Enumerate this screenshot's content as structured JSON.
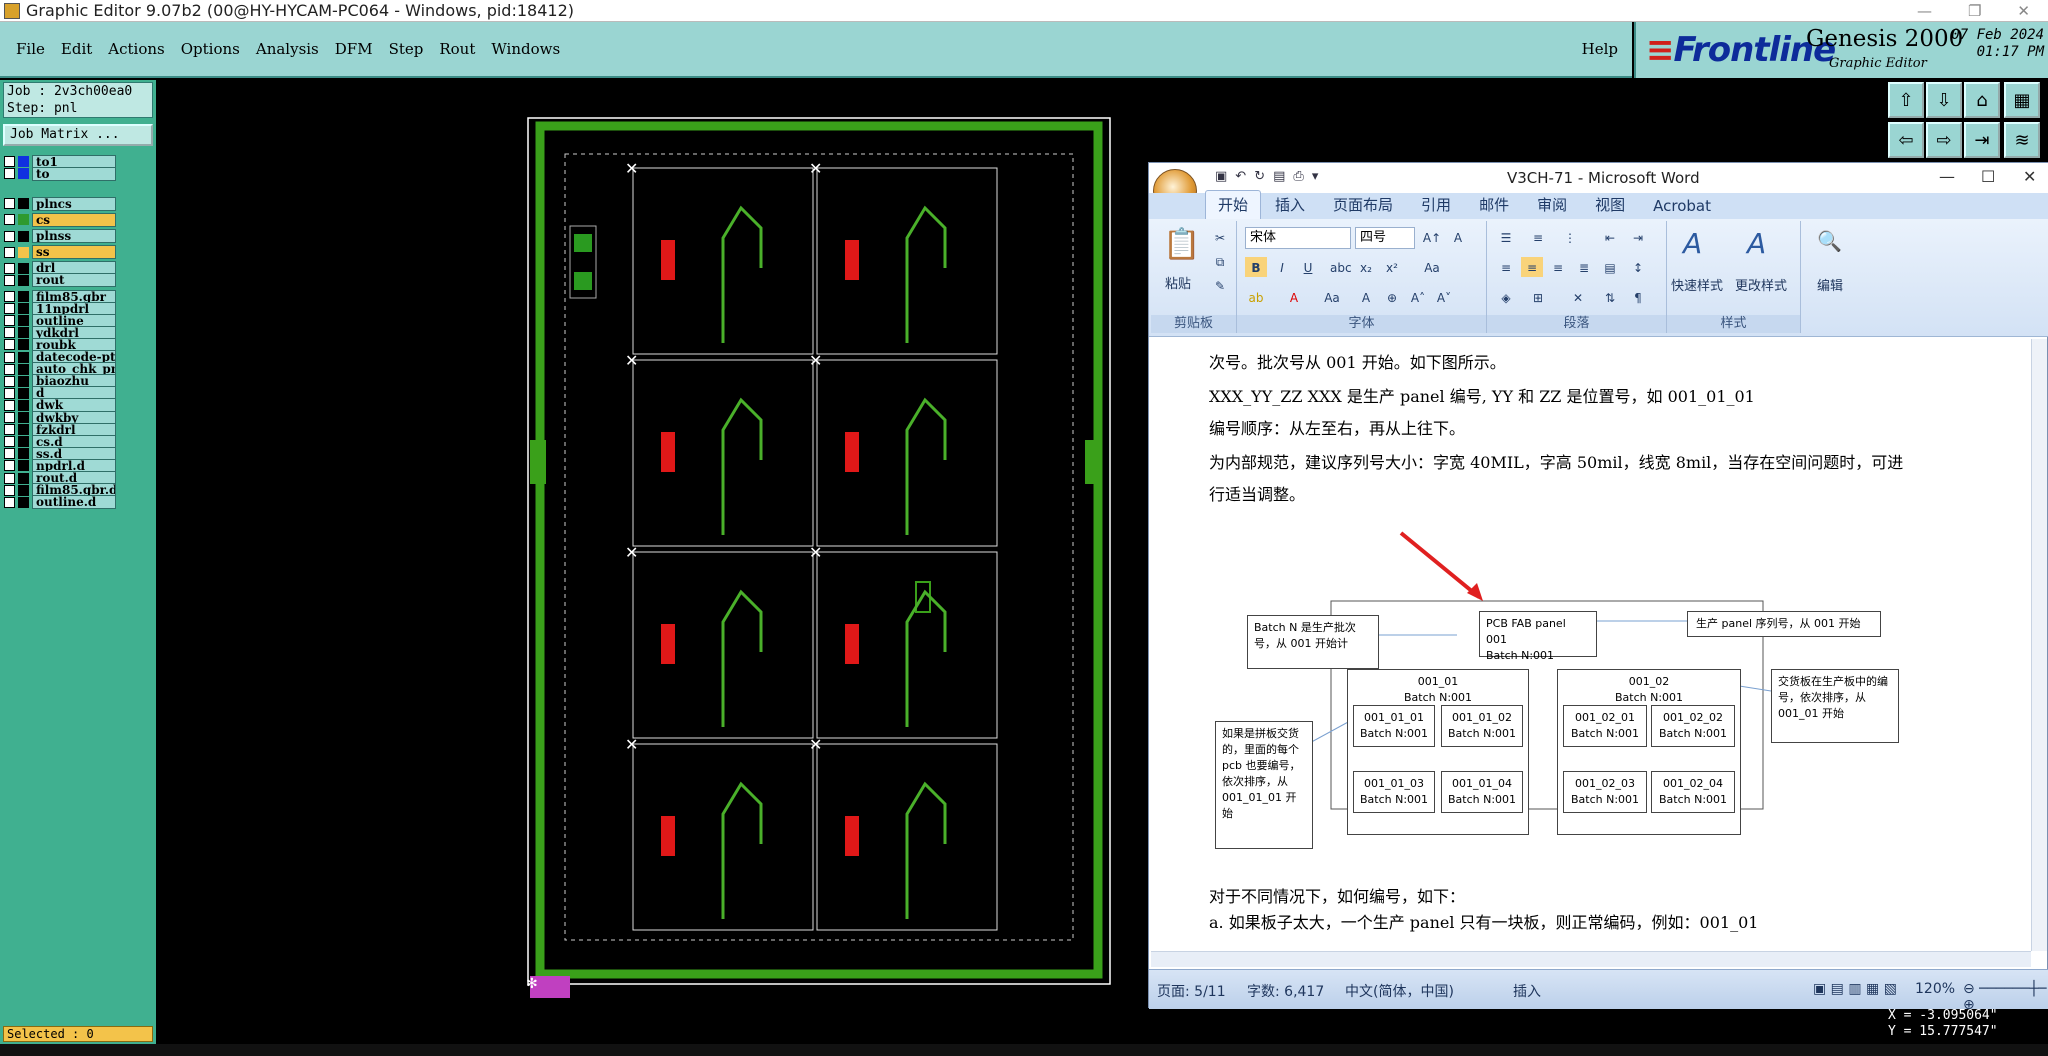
{
  "title_bar": {
    "text": "Graphic Editor 9.07b2 (00@HY-HYCAM-PC064 - Windows, pid:18412)"
  },
  "menu": {
    "items": [
      "File",
      "Edit",
      "Actions",
      "Options",
      "Analysis",
      "DFM",
      "Step",
      "Rout",
      "Windows"
    ],
    "help": "Help"
  },
  "logo": {
    "brand": "Frontline",
    "product": "Genesis 2000",
    "sub": "Graphic Editor",
    "date": "07 Feb 2024",
    "time": "01:17 PM"
  },
  "job": {
    "job_line": "Job : 2v3ch00ea0",
    "step_line": "Step: pnl",
    "matrix_button": "Job Matrix ..."
  },
  "layers": [
    {
      "name": "to1",
      "color": "#1030e0"
    },
    {
      "name": "to",
      "color": "#1030e0"
    },
    {
      "name": "plncs",
      "color": "#000000"
    },
    {
      "name": "cs",
      "color": "#2e9a2e"
    },
    {
      "name": "plnss",
      "color": "#000000"
    },
    {
      "name": "ss",
      "color": "#f3c34a"
    },
    {
      "name": "drl",
      "color": "#000000"
    },
    {
      "name": "rout",
      "color": "#000000"
    },
    {
      "name": "film85.gbr",
      "color": "#000000"
    },
    {
      "name": "11npdrl",
      "color": "#000000"
    },
    {
      "name": "outline",
      "color": "#000000"
    },
    {
      "name": "ydkdrl",
      "color": "#000000"
    },
    {
      "name": "roubk",
      "color": "#000000"
    },
    {
      "name": "datecode-pt",
      "color": "#000000"
    },
    {
      "name": "auto_chk_pn",
      "color": "#000000"
    },
    {
      "name": "biaozhu",
      "color": "#000000"
    },
    {
      "name": "d",
      "color": "#000000"
    },
    {
      "name": "dwk",
      "color": "#000000"
    },
    {
      "name": "dwkby",
      "color": "#000000"
    },
    {
      "name": "fzkdrl",
      "color": "#000000"
    },
    {
      "name": "cs.d",
      "color": "#000000"
    },
    {
      "name": "ss.d",
      "color": "#000000"
    },
    {
      "name": "npdrl.d",
      "color": "#000000"
    },
    {
      "name": "rout.d",
      "color": "#000000"
    },
    {
      "name": "film85.gbr.d",
      "color": "#000000"
    },
    {
      "name": "outline.d",
      "color": "#000000"
    }
  ],
  "selected": "Selected : 0",
  "coords": {
    "x": "X = -3.095064\"",
    "y": "Y = 15.777547\""
  },
  "word": {
    "title": "V3CH-71 - Microsoft Word",
    "tabs": [
      "开始",
      "插入",
      "页面布局",
      "引用",
      "邮件",
      "审阅",
      "视图",
      "Acrobat"
    ],
    "ribbon": {
      "font_name": "宋体",
      "font_size": "四号",
      "paste": "粘贴",
      "quick_styles": "快速样式",
      "change_styles": "更改样式",
      "edit": "编辑",
      "groups": [
        "剪贴板",
        "字体",
        "段落",
        "样式"
      ]
    },
    "doc_lines": [
      "次号。批次号从 001 开始。如下图所示。",
      "XXX_YY_ZZ   XXX 是生产 panel 编号, YY  和  ZZ   是位置号，如 001_01_01",
      "编号顺序：从左至右，再从上往下。",
      "为内部规范，建议序列号大小：字宽 40MIL，字高 50mil，线宽 8mil，当存在空间问题时，可进",
      "行适当调整。",
      "对于不同情况下，如何编号，如下：",
      "a.   如果板子太大，一个生产 panel 只有一块板，则正常编码，例如：001_01"
    ],
    "diagram": {
      "batch_note": "Batch  N  是生产批次号，从 001 开始计",
      "pcb_fab": "PCB  FAB  panel 001",
      "batch_n": "Batch N:001",
      "serial_note": "生产 panel  序列号，从 001 开始",
      "group1": "001_01",
      "group2": "001_02",
      "delivery_note": "交货板在生产板中的编号，依次排序，从 001_01 开始",
      "jigsaw_note": "如果是拼板交货的，里面的每个 pcb 也要编号，依次排序，从 001_01_01 开始",
      "cells": [
        "001_01_01",
        "001_01_02",
        "001_01_03",
        "001_01_04",
        "001_02_01",
        "001_02_02",
        "001_02_03",
        "001_02_04"
      ]
    },
    "status": {
      "page": "页面: 5/11",
      "words": "字数: 6,417",
      "lang": "中文(简体，中国)",
      "mode": "插入",
      "zoom": "120%"
    }
  }
}
